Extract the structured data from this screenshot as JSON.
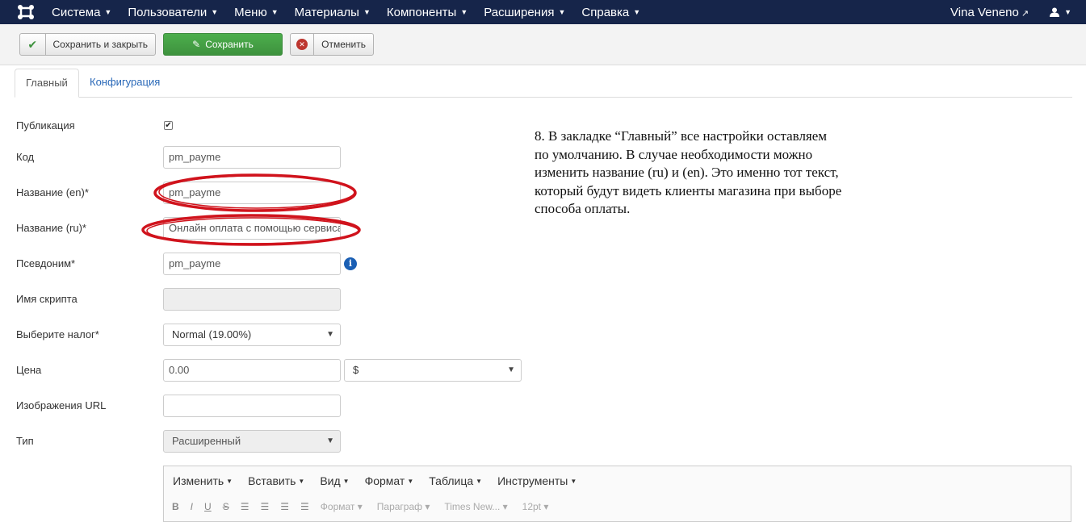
{
  "navbar": {
    "logo_icon": "joomla-logo-icon",
    "menu": [
      {
        "label": "Система"
      },
      {
        "label": "Пользователи"
      },
      {
        "label": "Меню"
      },
      {
        "label": "Материалы"
      },
      {
        "label": "Компоненты"
      },
      {
        "label": "Расширения"
      },
      {
        "label": "Справка"
      }
    ],
    "site_name": "Vina Veneno",
    "user_icon": "user-icon"
  },
  "toolbar": {
    "save_close_label": "Сохранить и закрыть",
    "save_label": "Сохранить",
    "cancel_label": "Отменить",
    "save_color": "#46a546"
  },
  "tabs": [
    {
      "label": "Главный",
      "active": true
    },
    {
      "label": "Конфигурация",
      "active": false
    }
  ],
  "form": {
    "publication": {
      "label": "Публикация",
      "checked": true
    },
    "code": {
      "label": "Код",
      "value": "pm_payme"
    },
    "name_en": {
      "label": "Название (en)*",
      "value": "pm_payme"
    },
    "name_ru": {
      "label": "Название (ru)*",
      "value": "Онлайн оплата с помощью сервиса"
    },
    "alias": {
      "label": "Псевдоним*",
      "value": "pm_payme"
    },
    "script_name": {
      "label": "Имя скрипта",
      "value": ""
    },
    "tax": {
      "label": "Выберите налог*",
      "value": "Normal (19.00%)"
    },
    "price": {
      "label": "Цена",
      "value": "0.00",
      "currency": "$"
    },
    "image_url": {
      "label": "Изображения URL",
      "value": ""
    },
    "type": {
      "label": "Тип",
      "value": "Расширенный"
    }
  },
  "annotation": {
    "lines": [
      "8. В закладке “Главный” все настройки оставляем",
      "по умолчанию. В случае необходимости можно",
      "изменить название  (ru) и (en). Это именно тот текст,",
      "который будут видеть клиенты магазина при выборе",
      "способа оплаты."
    ],
    "highlight_color": "#d0131c"
  },
  "editor": {
    "menu": [
      "Изменить",
      "Вставить",
      "Вид",
      "Формат",
      "Таблица",
      "Инструменты"
    ],
    "toolbar": {
      "format": "Формат",
      "paragraph": "Параграф",
      "font": "Times New...",
      "size": "12pt"
    }
  }
}
